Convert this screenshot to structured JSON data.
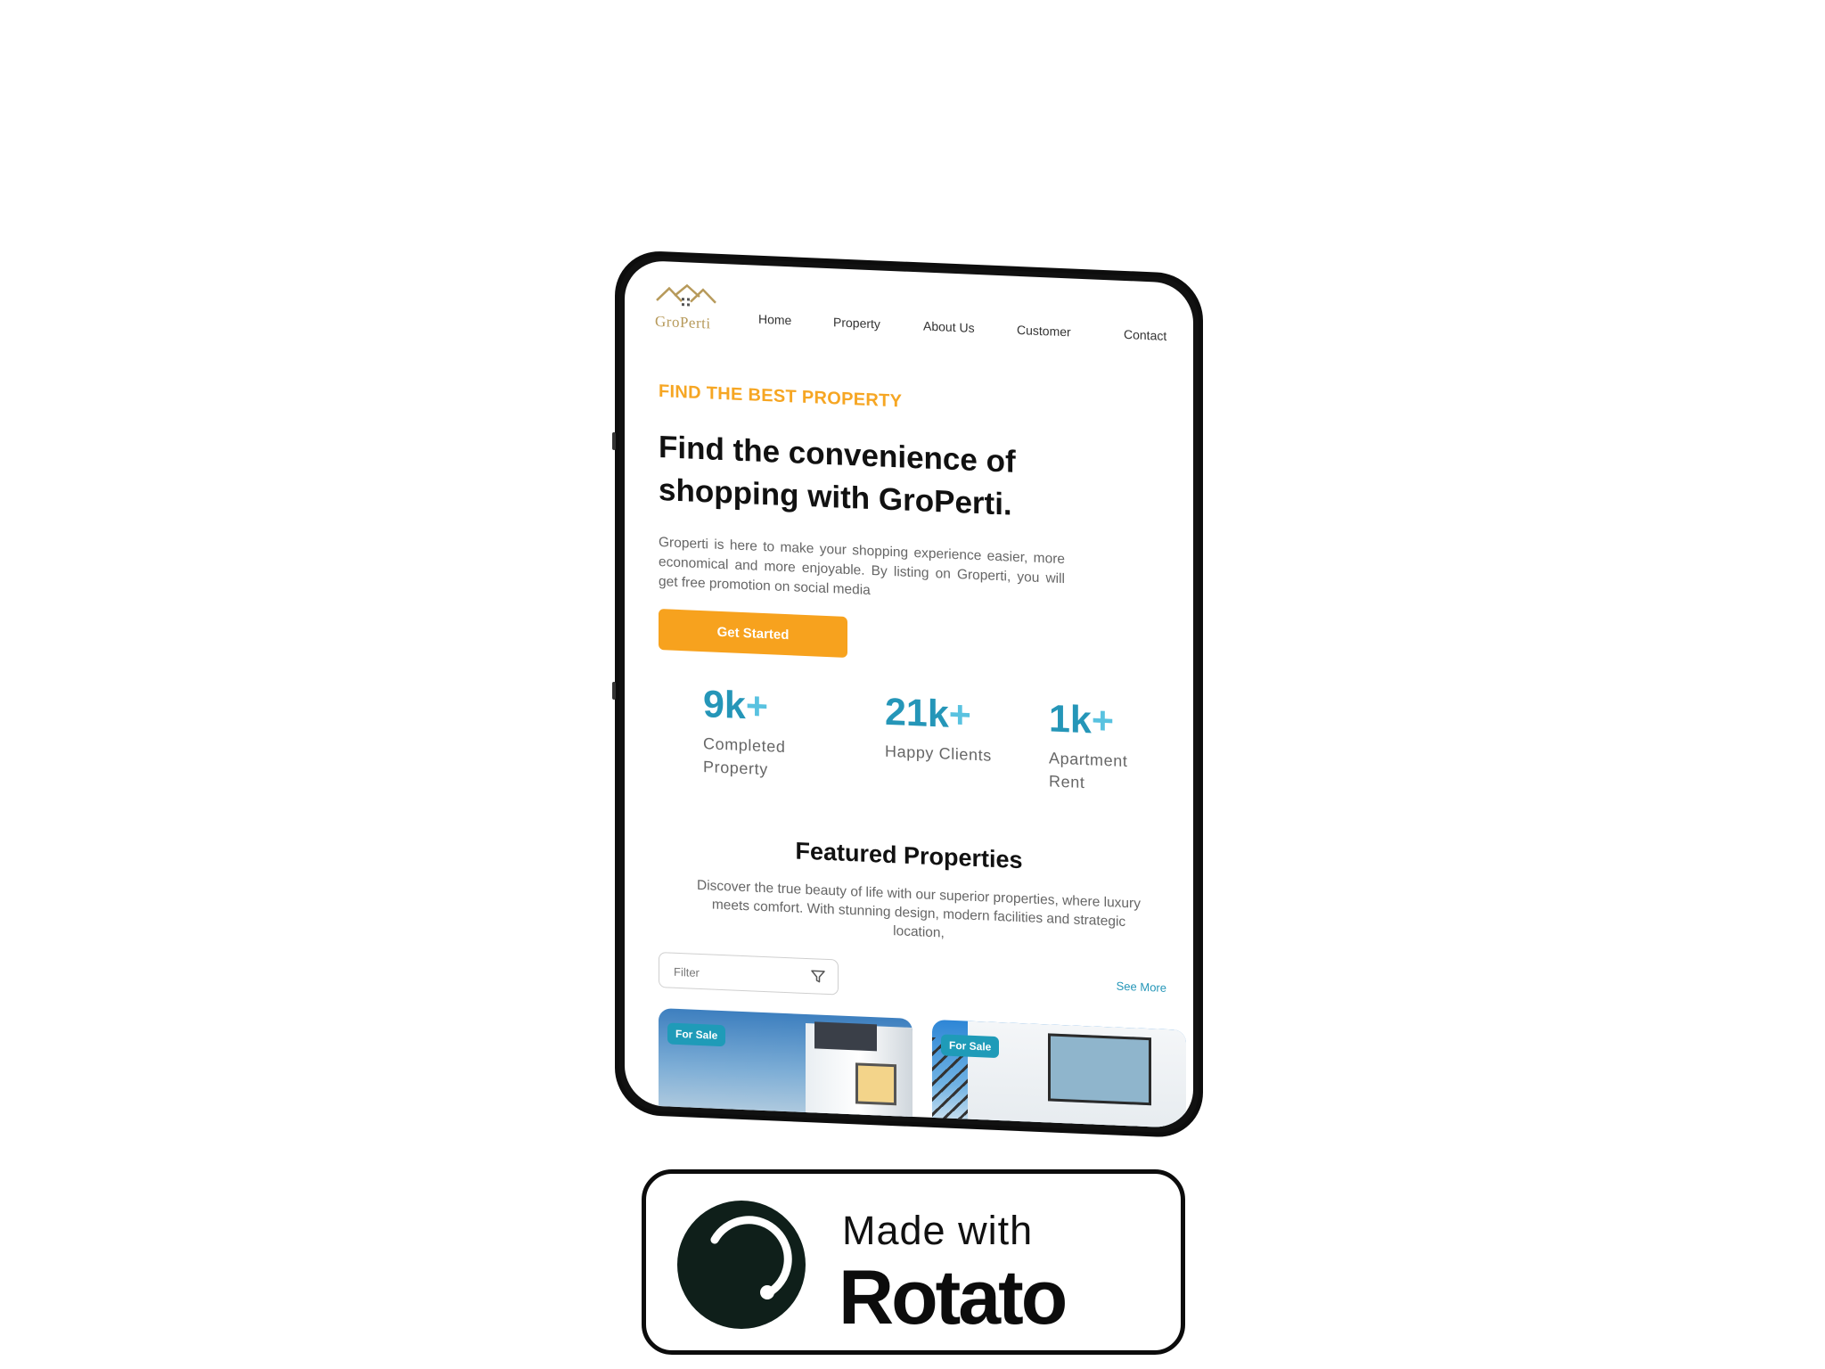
{
  "brand": {
    "name": "GroPerti",
    "accent": "#f7a21e",
    "secondary": "#2596b8",
    "logo_color": "#b79a5b"
  },
  "nav": {
    "items": [
      "Home",
      "Property",
      "About Us",
      "Customer",
      "Contact"
    ]
  },
  "hero": {
    "eyebrow": "FIND THE BEST PROPERTY",
    "title": "Find the convenience of shopping with GroPerti.",
    "description": "Groperti is here to make your shopping experience easier, more economical and more enjoyable. By listing on Groperti, you will get free promotion on social media",
    "cta_label": "Get Started"
  },
  "stats": [
    {
      "value": "9k",
      "suffix": "+",
      "label": "Completed Property"
    },
    {
      "value": "21k",
      "suffix": "+",
      "label": "Happy Clients"
    },
    {
      "value": "1k",
      "suffix": "+",
      "label": "Apartment Rent"
    }
  ],
  "featured": {
    "title": "Featured Properties",
    "description": "Discover the true beauty of life with our superior properties, where luxury meets comfort. With stunning design, modern facilities and strategic location,",
    "filter_placeholder": "Filter",
    "see_more": "See More",
    "cards": [
      {
        "badge": "For Sale"
      },
      {
        "badge": "For Sale"
      }
    ]
  },
  "watermark": {
    "prefix": "Made with",
    "name": "Rotato"
  },
  "icons": {
    "logo": "house-roof-logo-icon",
    "filter": "filter-funnel-icon",
    "rotato": "rotato-logo-icon"
  }
}
